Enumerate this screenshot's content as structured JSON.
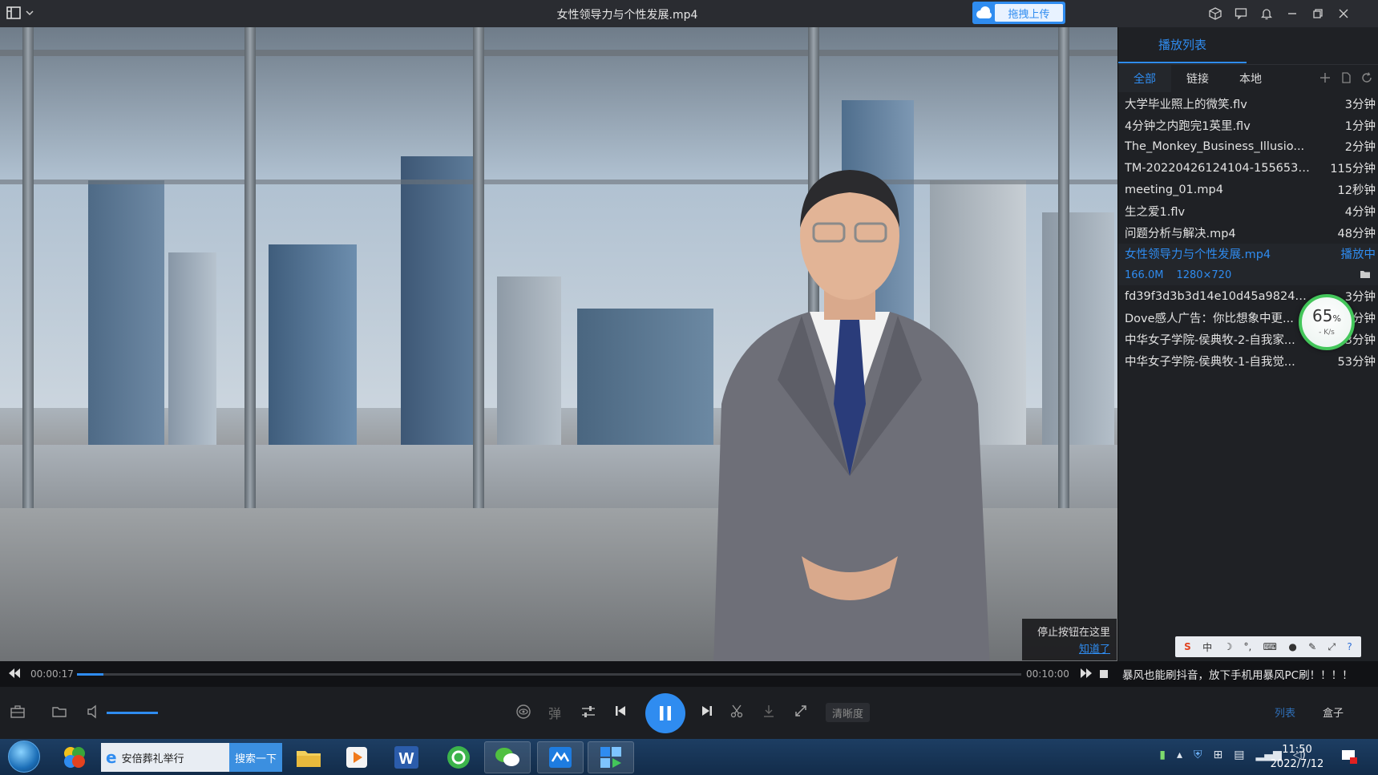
{
  "window": {
    "title": "女性领导力与个性发展.mp4",
    "upload_label": "拖拽上传"
  },
  "overlay_tip": {
    "text": "停止按钮在这里",
    "link": "知道了"
  },
  "progress": {
    "current": "00:00:17",
    "total": "00:10:00",
    "fraction": 0.028
  },
  "controls": {
    "clarity_label": "清晰度",
    "danmaku_label": "弹",
    "volume_level": 0.85,
    "list_tab": "列表",
    "box_tab": "盒子"
  },
  "playlist": {
    "title": "播放列表",
    "tabs": [
      "全部",
      "链接",
      "本地"
    ],
    "active_tab": "全部",
    "items": [
      {
        "name": "大学毕业照上的微笑.flv",
        "duration": "3分钟"
      },
      {
        "name": "4分钟之内跑完1英里.flv",
        "duration": "1分钟"
      },
      {
        "name": "The_Monkey_Business_Illusio...",
        "duration": "2分钟"
      },
      {
        "name": "TM-20220426124104-1556538...",
        "duration": "115分钟"
      },
      {
        "name": "meeting_01.mp4",
        "duration": "12秒钟"
      },
      {
        "name": "生之爱1.flv",
        "duration": "4分钟"
      },
      {
        "name": "问题分析与解决.mp4",
        "duration": "48分钟"
      },
      {
        "name": "女性领导力与个性发展.mp4",
        "duration": "播放中"
      },
      {
        "name": "fd39f3d3b3d14e10d45a98244...",
        "duration": "3分钟"
      },
      {
        "name": "Dove感人广告：你比想象中更...",
        "duration": "3分钟"
      },
      {
        "name": "中华女子学院-侯典牧-2-自我家...",
        "duration": "3分钟"
      },
      {
        "name": "中华女子学院-侯典牧-1-自我觉...",
        "duration": "53分钟"
      }
    ],
    "playing_info": {
      "size": "166.0M",
      "resolution": "1280×720"
    }
  },
  "speed_ball": {
    "percent": "65",
    "unit": "%",
    "rate": "- K/s"
  },
  "ad_text": "暴风也能刷抖音，放下手机用暴风PC刷！！！！",
  "taskbar": {
    "ie_label": "安倍葬礼举行",
    "search_label": "搜索一下",
    "time": "11:50",
    "date": "2022/7/12"
  },
  "ime": {
    "brand": "S",
    "mode": "中"
  },
  "colors": {
    "accent": "#2f8cf0",
    "ring": "#43c65a"
  }
}
